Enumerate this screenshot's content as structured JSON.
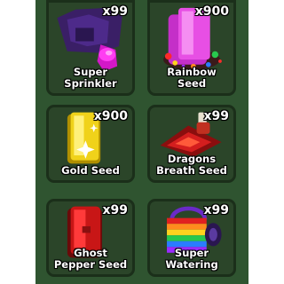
{
  "inventory": {
    "items": [
      {
        "name_line1": "Super",
        "name_line2": "Sprinkler",
        "count": "x99",
        "icon": "super-sprinkler-icon"
      },
      {
        "name_line1": "Rainbow",
        "name_line2": "Seed",
        "count": "x900",
        "icon": "rainbow-seed-icon"
      },
      {
        "name_line1": "Gold Seed",
        "name_line2": "",
        "count": "x900",
        "icon": "gold-seed-icon"
      },
      {
        "name_line1": "Dragons",
        "name_line2": "Breath Seed",
        "count": "x99",
        "icon": "dragons-breath-seed-icon"
      },
      {
        "name_line1": "Ghost",
        "name_line2": "Pepper Seed",
        "count": "x99",
        "icon": "ghost-pepper-seed-icon"
      },
      {
        "name_line1": "Super",
        "name_line2": "Watering",
        "count": "x99",
        "icon": "super-watering-can-icon"
      }
    ]
  },
  "colors": {
    "panel_bg": "#2f5430",
    "slot_bg": "#2b4529",
    "slot_border": "#1b2f1a"
  }
}
